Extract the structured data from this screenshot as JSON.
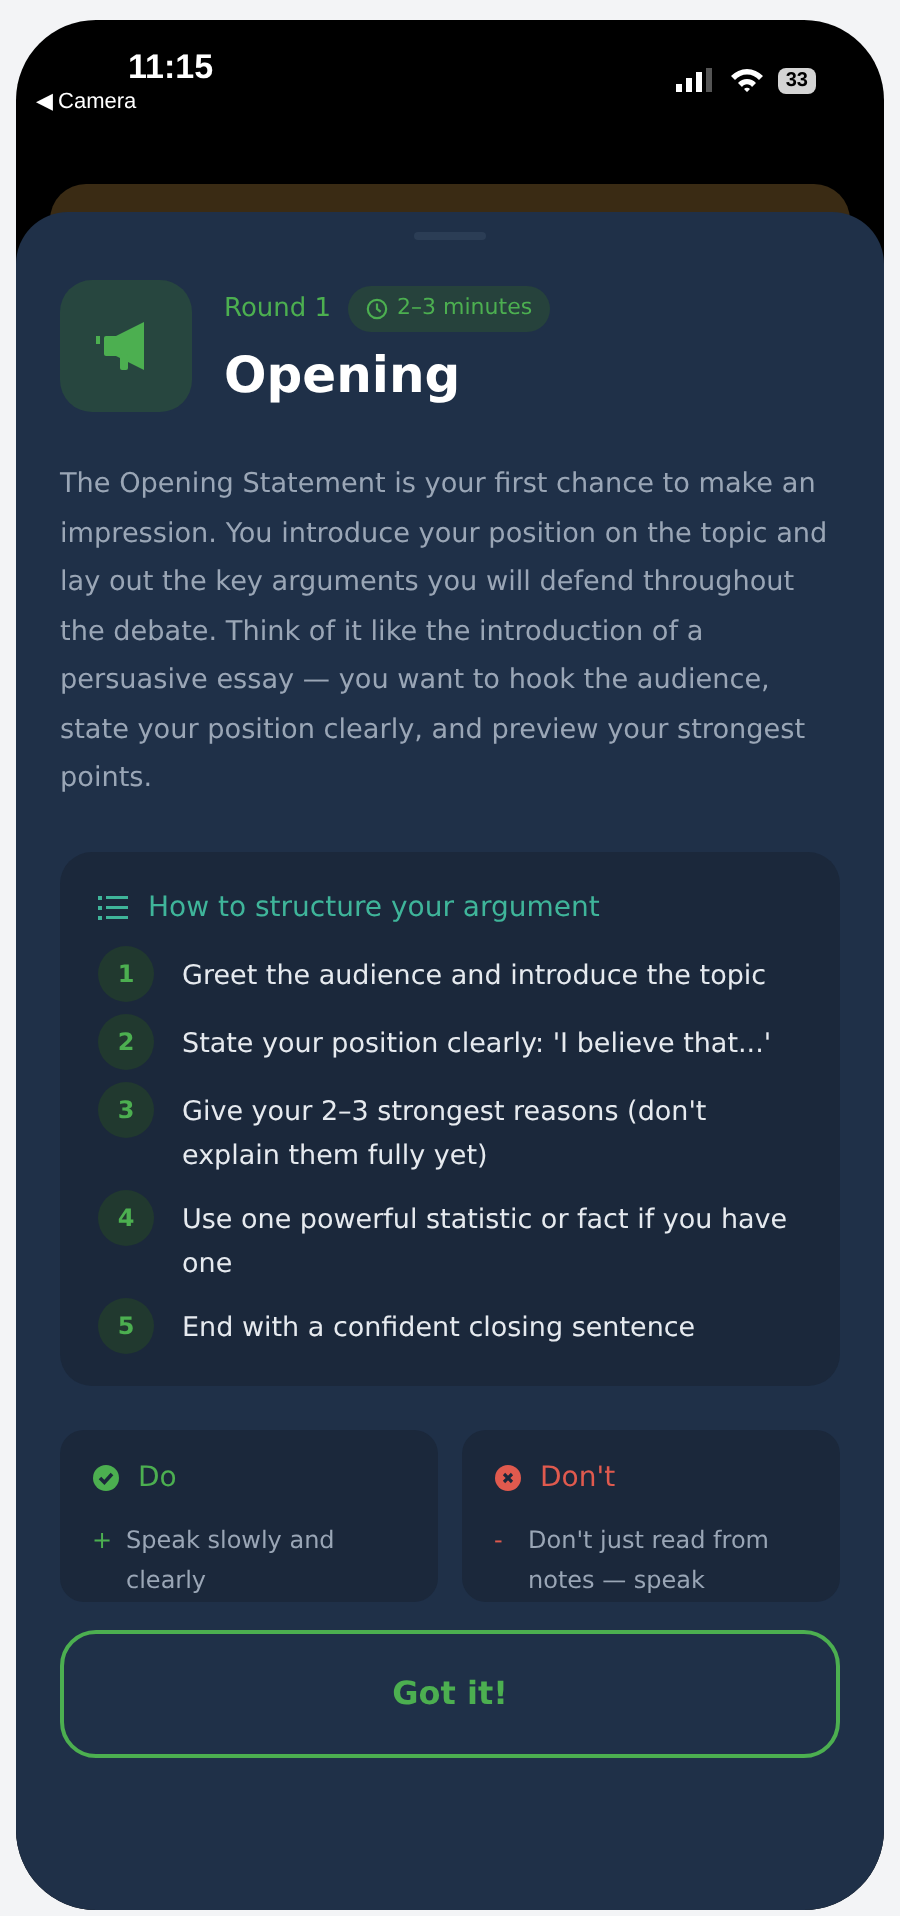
{
  "status_bar": {
    "time": "11:15",
    "back_label": "◀ Camera",
    "battery": "33"
  },
  "header": {
    "round": "Round 1",
    "duration": "2–3 minutes",
    "title": "Opening"
  },
  "description": "The Opening Statement is your first chance to make an impression. You introduce your position on the topic and lay out the key arguments you will defend throughout the debate. Think of it like the introduction of a persuasive essay — you want to hook the audience, state your position clearly, and preview your strongest points.",
  "structure": {
    "title": "How to structure your argument",
    "steps": [
      {
        "number": "1",
        "text": "Greet the audience and introduce the topic"
      },
      {
        "number": "2",
        "text": "State your position clearly: 'I believe that...'"
      },
      {
        "number": "3",
        "text": "Give your 2–3 strongest reasons (don't explain them fully yet)"
      },
      {
        "number": "4",
        "text": "Use one powerful statistic or fact if you have one"
      },
      {
        "number": "5",
        "text": "End with a confident closing sentence"
      }
    ]
  },
  "tips": [
    {
      "kind": "do",
      "title": "Do",
      "items": [
        {
          "marker": "+",
          "text": "Speak slowly and clearly"
        }
      ]
    },
    {
      "kind": "dont",
      "title": "Don't",
      "items": [
        {
          "marker": "-",
          "text": "Don't just read from notes — speak"
        }
      ]
    }
  ],
  "button": "Got it!"
}
